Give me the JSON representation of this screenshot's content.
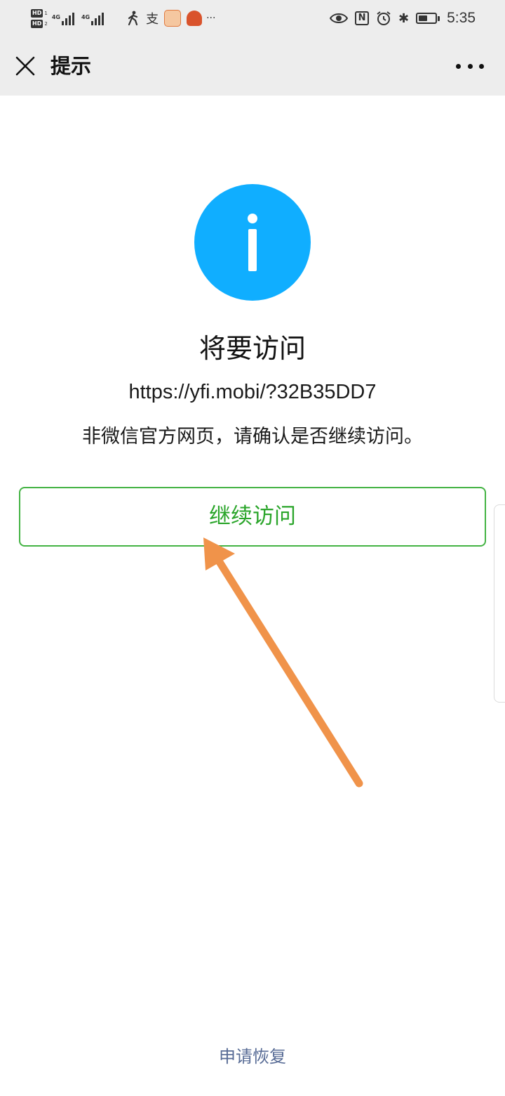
{
  "status_bar": {
    "time": "5:35",
    "sim1_badge": "HD",
    "sim1_index": "1",
    "sim2_badge": "HD",
    "sim2_index": "2",
    "net1_type": "4G",
    "net2_type": "4G",
    "icons": [
      "walk-icon",
      "alipay-icon",
      "app-icon",
      "app-icon",
      "more-dots-icon",
      "eye-icon",
      "nfc-icon",
      "alarm-icon",
      "bluetooth-icon",
      "battery-icon"
    ],
    "more_glyph": "···",
    "alipay_glyph": "支",
    "nfc_glyph": "N",
    "bluetooth_glyph": "✱",
    "battery_level": 0.55
  },
  "nav": {
    "title": "提示"
  },
  "content": {
    "heading": "将要访问",
    "url": "https://yfi.mobi/?32B35DD7",
    "notice": "非微信官方网页，请确认是否继续访问。",
    "continue_label": "继续访问",
    "restore_label": "申请恢复"
  },
  "colors": {
    "info_blue": "#10aeff",
    "button_green": "#2aa52a",
    "link_blue": "#576b95",
    "arrow_orange": "#f0934a",
    "nav_gray": "#ededed"
  }
}
